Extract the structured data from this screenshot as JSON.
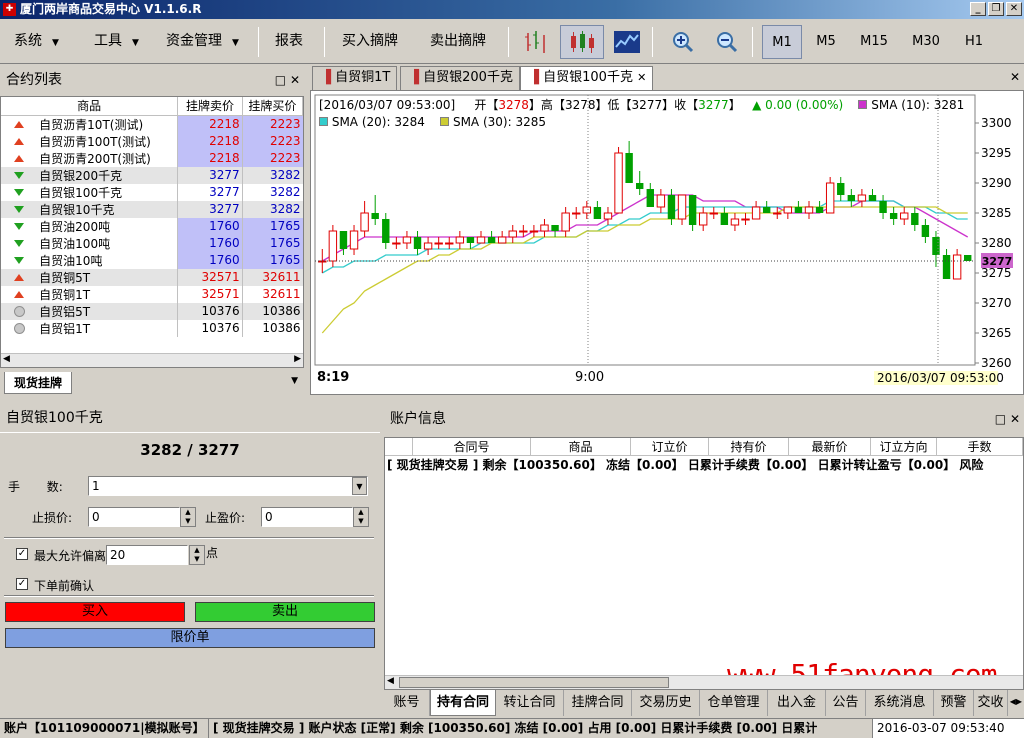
{
  "window": {
    "title": "厦门两岸商品交易中心 V1.1.6.R",
    "min": "_",
    "max": "❐",
    "close": "✕"
  },
  "menu": {
    "system": "系统",
    "tools": "工具",
    "funds": "资金管理",
    "report": "报表",
    "buy_list": "买入摘牌",
    "sell_list": "卖出摘牌"
  },
  "timeframes": [
    "M1",
    "M5",
    "M15",
    "M30",
    "H1"
  ],
  "contracts_panel": {
    "title": "合约列表",
    "headers": {
      "product": "商品",
      "sell": "挂牌卖价",
      "buy": "挂牌买价"
    },
    "rows": [
      {
        "dir": "up",
        "name": "自贸沥青10T(测试)",
        "sell": "2218",
        "buy": "2223",
        "color": "red",
        "shade": "blue"
      },
      {
        "dir": "up",
        "name": "自贸沥青100T(测试)",
        "sell": "2218",
        "buy": "2223",
        "color": "red",
        "shade": "blue"
      },
      {
        "dir": "up",
        "name": "自贸沥青200T(测试)",
        "sell": "2218",
        "buy": "2223",
        "color": "red",
        "shade": "blue"
      },
      {
        "dir": "down",
        "name": "自贸银200千克",
        "sell": "3277",
        "buy": "3282",
        "color": "blue",
        "shade": "gray"
      },
      {
        "dir": "down",
        "name": "自贸银100千克",
        "sell": "3277",
        "buy": "3282",
        "color": "blue",
        "shade": "none"
      },
      {
        "dir": "down",
        "name": "自贸银10千克",
        "sell": "3277",
        "buy": "3282",
        "color": "blue",
        "shade": "gray"
      },
      {
        "dir": "down",
        "name": "自贸油200吨",
        "sell": "1760",
        "buy": "1765",
        "color": "blue",
        "shade": "blue"
      },
      {
        "dir": "down",
        "name": "自贸油100吨",
        "sell": "1760",
        "buy": "1765",
        "color": "blue",
        "shade": "blue"
      },
      {
        "dir": "down",
        "name": "自贸油10吨",
        "sell": "1760",
        "buy": "1765",
        "color": "blue",
        "shade": "blue"
      },
      {
        "dir": "up",
        "name": "自贸铜5T",
        "sell": "32571",
        "buy": "32611",
        "color": "red",
        "shade": "gray"
      },
      {
        "dir": "up",
        "name": "自贸铜1T",
        "sell": "32571",
        "buy": "32611",
        "color": "red",
        "shade": "none"
      },
      {
        "dir": "flat",
        "name": "自贸铝5T",
        "sell": "10376",
        "buy": "10386",
        "color": "black",
        "shade": "gray"
      },
      {
        "dir": "flat",
        "name": "自贸铝1T",
        "sell": "10376",
        "buy": "10386",
        "color": "black",
        "shade": "none"
      }
    ],
    "bottom_tab": "现货挂牌"
  },
  "chart_tabs": [
    "自贸铜1T",
    "自贸银200千克",
    "自贸银100千克"
  ],
  "chart_header": {
    "time": "[2016/03/07 09:53:00]",
    "open_label": "开",
    "open": "3278",
    "high_label": "高",
    "high": "3278",
    "low_label": "低",
    "low": "3277",
    "close_label": "收",
    "close": "3277",
    "change": "▲ 0.00 (0.00%)",
    "sma10": "SMA (10): 3281",
    "sma20": "SMA (20): 3284",
    "sma30": "SMA (30): 3285",
    "x_start": "8:19",
    "x_mid": "9:00",
    "x_end": "2016/03/07 09:53:00",
    "last_price": "3277",
    "colors": {
      "up": "#e00000",
      "down": "#00a000",
      "sma10": "#cc33cc",
      "sma20": "#33cccc",
      "sma30": "#cccc33",
      "text_up": "#e00000",
      "text_down": "#00a000"
    }
  },
  "chart_data": {
    "type": "candlestick",
    "title": "",
    "ylim": [
      3260,
      3302
    ],
    "yticks": [
      3300,
      3295,
      3290,
      3285,
      3280,
      3275,
      3270,
      3265,
      3260
    ],
    "xticks": [
      "8:19",
      "9:00"
    ],
    "ohlc": [
      [
        3277,
        3279,
        3275,
        3277
      ],
      [
        3277,
        3283,
        3276,
        3282
      ],
      [
        3282,
        3282,
        3278,
        3279
      ],
      [
        3279,
        3283,
        3278,
        3282
      ],
      [
        3282,
        3287,
        3281,
        3285
      ],
      [
        3285,
        3288,
        3283,
        3284
      ],
      [
        3284,
        3285,
        3279,
        3280
      ],
      [
        3280,
        3281,
        3279,
        3280
      ],
      [
        3280,
        3282,
        3279,
        3281
      ],
      [
        3281,
        3282,
        3278,
        3279
      ],
      [
        3279,
        3281,
        3278,
        3280
      ],
      [
        3280,
        3281,
        3279,
        3280
      ],
      [
        3280,
        3281,
        3279,
        3280
      ],
      [
        3280,
        3282,
        3279,
        3281
      ],
      [
        3281,
        3281,
        3279,
        3280
      ],
      [
        3280,
        3282,
        3280,
        3281
      ],
      [
        3281,
        3282,
        3280,
        3280
      ],
      [
        3280,
        3282,
        3280,
        3281
      ],
      [
        3281,
        3283,
        3280,
        3282
      ],
      [
        3282,
        3283,
        3281,
        3282
      ],
      [
        3282,
        3283,
        3281,
        3282
      ],
      [
        3282,
        3284,
        3281,
        3283
      ],
      [
        3283,
        3283,
        3281,
        3282
      ],
      [
        3282,
        3286,
        3281,
        3285
      ],
      [
        3285,
        3286,
        3284,
        3285
      ],
      [
        3285,
        3287,
        3284,
        3286
      ],
      [
        3286,
        3287,
        3284,
        3284
      ],
      [
        3284,
        3286,
        3283,
        3285
      ],
      [
        3285,
        3296,
        3285,
        3295
      ],
      [
        3295,
        3297,
        3290,
        3290
      ],
      [
        3290,
        3292,
        3288,
        3289
      ],
      [
        3289,
        3290,
        3286,
        3286
      ],
      [
        3286,
        3289,
        3285,
        3288
      ],
      [
        3288,
        3289,
        3283,
        3284
      ],
      [
        3284,
        3288,
        3283,
        3288
      ],
      [
        3288,
        3288,
        3282,
        3283
      ],
      [
        3283,
        3286,
        3282,
        3285
      ],
      [
        3285,
        3286,
        3284,
        3285
      ],
      [
        3285,
        3286,
        3283,
        3283
      ],
      [
        3283,
        3285,
        3282,
        3284
      ],
      [
        3284,
        3285,
        3283,
        3284
      ],
      [
        3284,
        3287,
        3284,
        3286
      ],
      [
        3286,
        3287,
        3285,
        3285
      ],
      [
        3285,
        3286,
        3284,
        3285
      ],
      [
        3285,
        3286,
        3284,
        3286
      ],
      [
        3286,
        3287,
        3285,
        3285
      ],
      [
        3285,
        3287,
        3284,
        3286
      ],
      [
        3286,
        3287,
        3285,
        3285
      ],
      [
        3285,
        3291,
        3285,
        3290
      ],
      [
        3290,
        3291,
        3287,
        3288
      ],
      [
        3288,
        3289,
        3286,
        3287
      ],
      [
        3287,
        3289,
        3286,
        3288
      ],
      [
        3288,
        3289,
        3287,
        3287
      ],
      [
        3287,
        3288,
        3284,
        3285
      ],
      [
        3285,
        3286,
        3283,
        3284
      ],
      [
        3284,
        3286,
        3283,
        3285
      ],
      [
        3285,
        3286,
        3282,
        3283
      ],
      [
        3283,
        3284,
        3280,
        3281
      ],
      [
        3281,
        3282,
        3276,
        3278
      ],
      [
        3278,
        3279,
        3274,
        3274
      ],
      [
        3274,
        3279,
        3274,
        3278
      ],
      [
        3278,
        3278,
        3277,
        3277
      ]
    ],
    "series": [
      {
        "name": "SMA (10)",
        "values": [
          3277,
          3278,
          3279,
          3280,
          3281,
          3281,
          3281,
          3281,
          3281,
          3281,
          3281,
          3281,
          3281,
          3281,
          3281,
          3281,
          3281,
          3281,
          3281,
          3281,
          3282,
          3282,
          3282,
          3282,
          3283,
          3283,
          3283,
          3284,
          3285,
          3286,
          3287,
          3288,
          3288,
          3288,
          3288,
          3288,
          3287,
          3287,
          3287,
          3287,
          3286,
          3286,
          3286,
          3286,
          3285,
          3285,
          3285,
          3285,
          3286,
          3286,
          3286,
          3287,
          3287,
          3287,
          3287,
          3286,
          3286,
          3285,
          3284,
          3283,
          3282,
          3281
        ]
      },
      {
        "name": "SMA (20)",
        "values": [
          3275,
          3276,
          3276,
          3277,
          3277,
          3277,
          3278,
          3278,
          3278,
          3278,
          3279,
          3279,
          3279,
          3279,
          3279,
          3280,
          3280,
          3280,
          3280,
          3280,
          3280,
          3281,
          3281,
          3281,
          3281,
          3282,
          3282,
          3283,
          3283,
          3284,
          3284,
          3285,
          3285,
          3285,
          3286,
          3286,
          3286,
          3286,
          3286,
          3286,
          3286,
          3286,
          3286,
          3286,
          3286,
          3286,
          3286,
          3286,
          3287,
          3287,
          3287,
          3287,
          3287,
          3287,
          3287,
          3286,
          3286,
          3286,
          3285,
          3285,
          3284,
          3284
        ]
      },
      {
        "name": "SMA (30)",
        "values": [
          3265,
          3267,
          3269,
          3270,
          3272,
          3273,
          3274,
          3275,
          3276,
          3277,
          3277,
          3278,
          3278,
          3279,
          3279,
          3279,
          3280,
          3280,
          3280,
          3280,
          3281,
          3281,
          3281,
          3281,
          3281,
          3282,
          3282,
          3282,
          3283,
          3283,
          3283,
          3284,
          3284,
          3284,
          3284,
          3285,
          3285,
          3285,
          3285,
          3285,
          3285,
          3285,
          3285,
          3285,
          3286,
          3286,
          3286,
          3286,
          3286,
          3286,
          3286,
          3286,
          3286,
          3286,
          3286,
          3286,
          3286,
          3286,
          3286,
          3285,
          3285,
          3285
        ]
      }
    ]
  },
  "order_panel": {
    "title": "自贸银100千克",
    "price": "3282 / 3277",
    "qty_label": "手       数:",
    "qty": "1",
    "stop_label": "止损价:",
    "stop": "0",
    "profit_label": "止盈价:",
    "profit": "0",
    "deviation_label": "最大允许偏离",
    "deviation": "20",
    "deviation_unit": "点",
    "confirm_label": "下单前确认",
    "buy": "买入",
    "sell": "卖出",
    "limit": "限价单"
  },
  "account_panel": {
    "title": "账户信息",
    "headers": [
      "合同号",
      "商品",
      "订立价",
      "持有价",
      "最新价",
      "订立方向",
      "手数"
    ],
    "summary": "[ 现货挂牌交易 ] 剩余【100350.60】 冻结【0.00】 日累计手续费【0.00】 日累计转让盈亏【0.00】 风险",
    "watermark": "www.51fanyong.com",
    "tabs": [
      "账号",
      "持有合同",
      "转让合同",
      "挂牌合同",
      "交易历史",
      "仓单管理",
      "出入金",
      "公告",
      "系统消息",
      "预警",
      "交收"
    ]
  },
  "status_bar": {
    "account": "账户【101109000071|模拟账号】",
    "info": "[ 现货挂牌交易 ] 账户状态 [正常] 剩余 [100350.60] 冻结 [0.00] 占用 [0.00] 日累计手续费 [0.00] 日累计",
    "time": "2016-03-07  09:53:40"
  }
}
